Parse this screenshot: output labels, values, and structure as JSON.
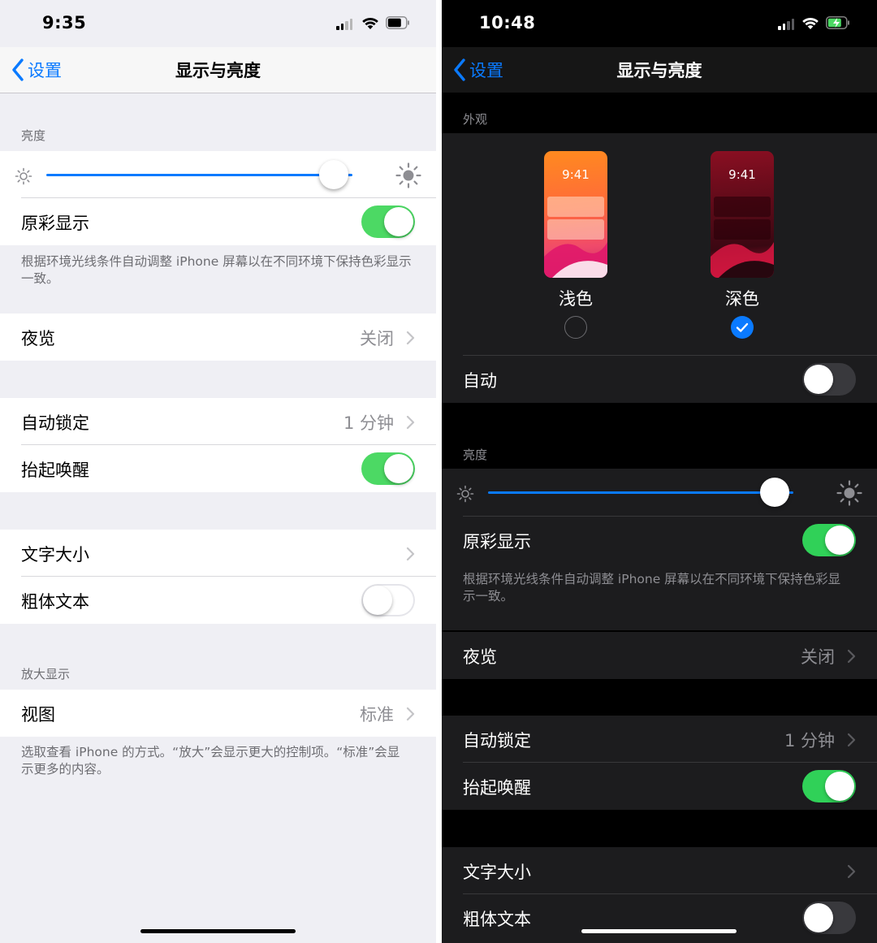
{
  "light": {
    "status": {
      "time": "9:35"
    },
    "nav": {
      "back_label": "设置",
      "title": "显示与亮度"
    },
    "brightness": {
      "header": "亮度",
      "level": 0.94
    },
    "true_tone": {
      "label": "原彩显示",
      "on": true
    },
    "true_tone_footer": "根据环境光线条件自动调整 iPhone 屏幕以在不同环境下保持色彩显示一致。",
    "night_shift": {
      "label": "夜览",
      "value": "关闭"
    },
    "auto_lock": {
      "label": "自动锁定",
      "value": "1 分钟"
    },
    "raise_to_wake": {
      "label": "抬起唤醒",
      "on": true
    },
    "text_size": {
      "label": "文字大小"
    },
    "bold_text": {
      "label": "粗体文本",
      "on": false
    },
    "zoom": {
      "header": "放大显示",
      "label": "视图",
      "value": "标准"
    },
    "zoom_footer": "选取查看 iPhone 的方式。“放大”会显示更大的控制项。“标准”会显示更多的内容。"
  },
  "dark": {
    "status": {
      "time": "10:48"
    },
    "nav": {
      "back_label": "设置",
      "title": "显示与亮度"
    },
    "appearance": {
      "header": "外观",
      "light_label": "浅色",
      "dark_label": "深色",
      "preview_time": "9:41",
      "selected": "dark"
    },
    "automatic": {
      "label": "自动",
      "on": false
    },
    "brightness": {
      "header": "亮度",
      "level": 0.94
    },
    "true_tone": {
      "label": "原彩显示",
      "on": true
    },
    "true_tone_footer": "根据环境光线条件自动调整 iPhone 屏幕以在不同环境下保持色彩显示一致。",
    "night_shift": {
      "label": "夜览",
      "value": "关闭"
    },
    "auto_lock": {
      "label": "自动锁定",
      "value": "1 分钟"
    },
    "raise_to_wake": {
      "label": "抬起唤醒",
      "on": true
    },
    "text_size": {
      "label": "文字大小"
    },
    "bold_text": {
      "label": "粗体文本",
      "on": false
    }
  },
  "colors": {
    "accent": "#0a7aff",
    "toggle_on": "#4cd964",
    "toggle_on_dark": "#30d158",
    "battery_charging": "#4cd964"
  },
  "icons": [
    "chevron-left-icon",
    "chevron-right-icon",
    "sun-small-icon",
    "sun-large-icon",
    "cellular-signal-icon",
    "wifi-icon",
    "battery-icon",
    "checkmark-icon"
  ]
}
